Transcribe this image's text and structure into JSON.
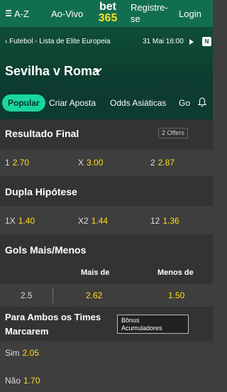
{
  "topbar": {
    "az_label": "A-Z",
    "live_label": "Ao-Vivo",
    "logo_top": "bet",
    "logo_bottom": "365",
    "register_label": "Registre-se",
    "login_label": "Login"
  },
  "header": {
    "breadcrumb": "Futebol - Lista de Elite Europeia",
    "datetime": "31 Mai 16:00",
    "n_badge": "N",
    "match_title": "Sevilha v Roma"
  },
  "tabs": [
    "Popular",
    "Criar Aposta",
    "Odds Asiáticas",
    "Go"
  ],
  "markets": {
    "resultado_final": {
      "title": "Resultado Final",
      "badge": "2 Offers",
      "odds": [
        {
          "label": "1",
          "value": "2.70"
        },
        {
          "label": "X",
          "value": "3.00"
        },
        {
          "label": "2",
          "value": "2.87"
        }
      ]
    },
    "dupla_hipotese": {
      "title": "Dupla Hipótese",
      "odds": [
        {
          "label": "1X",
          "value": "1.40"
        },
        {
          "label": "X2",
          "value": "1.44"
        },
        {
          "label": "12",
          "value": "1.36"
        }
      ]
    },
    "gols": {
      "title": "Gols Mais/Menos",
      "col_over": "Mais de",
      "col_under": "Menos de",
      "line": "2.5",
      "over": "2.62",
      "under": "1.50"
    },
    "ambos": {
      "title_line1": "Para Ambos os Times",
      "title_line2": "Marcarem",
      "bonus_line1": "Bônus",
      "bonus_line2": "Acumuladores",
      "odds": [
        {
          "label": "Sim",
          "value": "2.05"
        },
        {
          "label": "Não",
          "value": "1.70"
        }
      ]
    }
  },
  "colors": {
    "brand_green": "#126e51",
    "odds_yellow": "#ffdf1b",
    "active_tab": "#19d6a0"
  }
}
